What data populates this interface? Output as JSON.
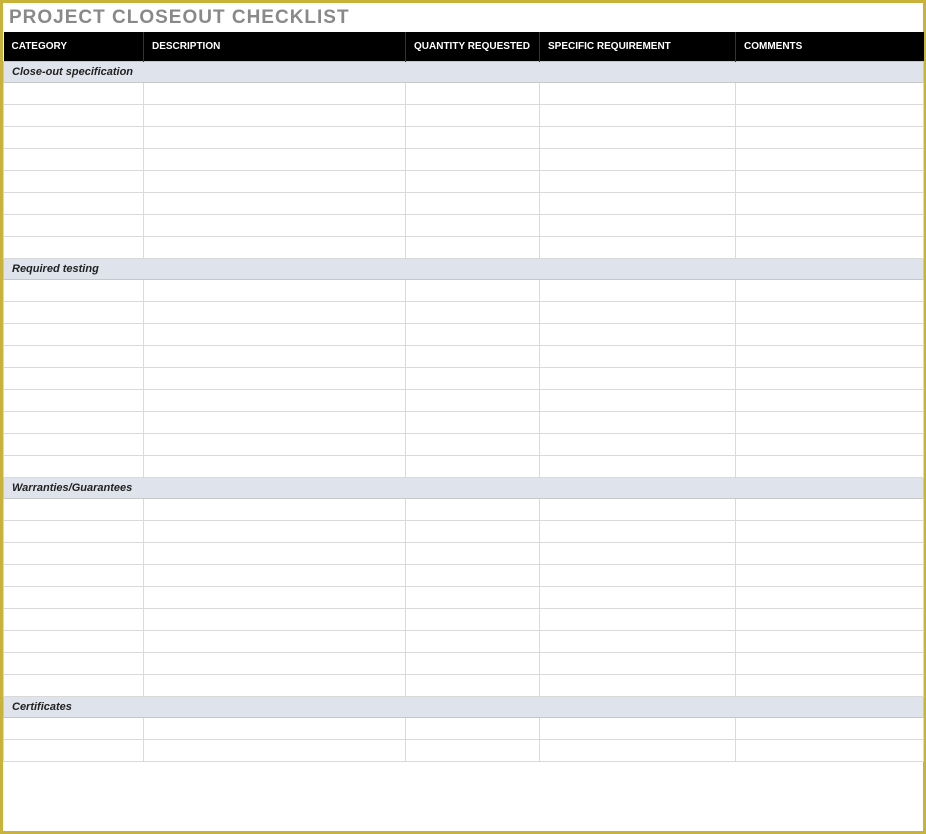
{
  "title": "PROJECT CLOSEOUT CHECKLIST",
  "columns": [
    "CATEGORY",
    "DESCRIPTION",
    "QUANTITY REQUESTED",
    "SPECIFIC REQUIREMENT",
    "COMMENTS"
  ],
  "sections": [
    {
      "label": "Close-out specification",
      "rows": 8
    },
    {
      "label": "Required testing",
      "rows": 9
    },
    {
      "label": "Warranties/Guarantees",
      "rows": 9
    },
    {
      "label": "Certificates",
      "rows": 2
    }
  ]
}
